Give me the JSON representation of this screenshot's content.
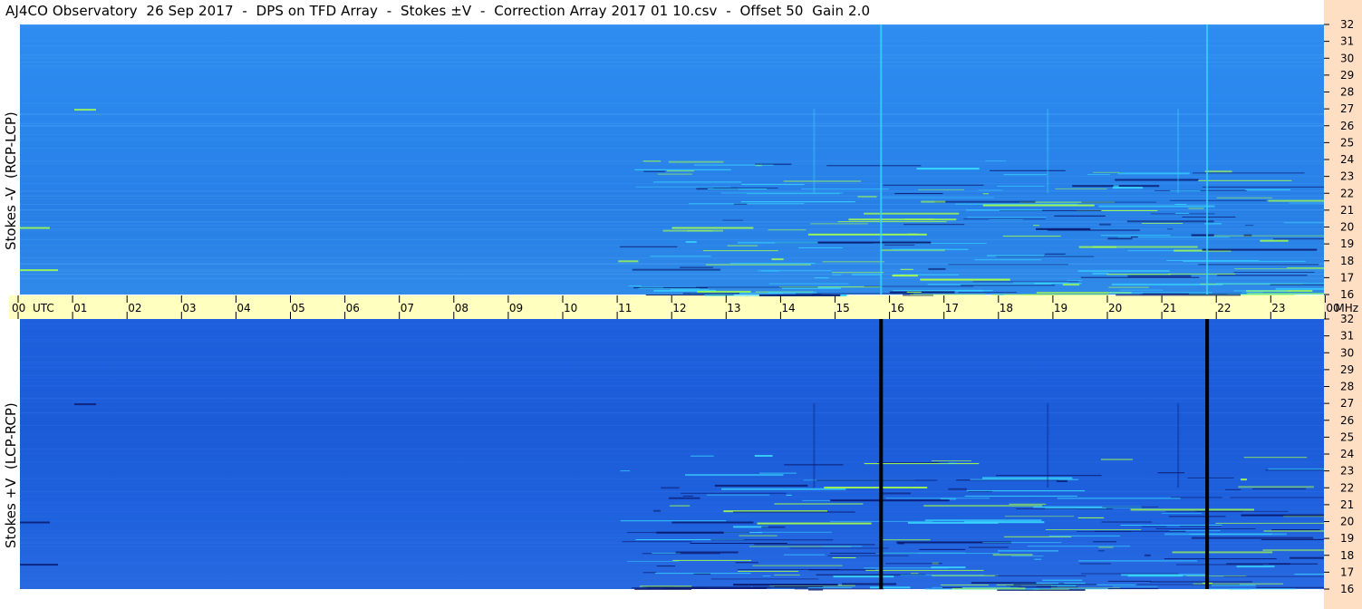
{
  "title": "AJ4CO Observatory  26 Sep 2017  -  DPS on TFD Array  -  Stokes ±V  -  Correction Array 2017 01 10.csv  -  Offset 50  Gain 2.0",
  "colors": {
    "background": "#ffffff",
    "time_bar": "#ffffc0",
    "right_strip": "#ffdfc4",
    "top_panel": "#2a86ec",
    "bottom_panel": "#1d5fdc",
    "emission_bright": "#a6ff4a",
    "emission_cyan": "#39d7ff",
    "emission_dark": "#0a1a70"
  },
  "chart_data": [
    {
      "type": "heatmap",
      "title": "AJ4CO Observatory  26 Sep 2017  -  DPS on TFD Array  -  Stokes ±V  -  Correction Array 2017 01 10.csv  -  Offset 50  Gain 2.0",
      "panel": "top",
      "ylabel": "Stokes -V  (RCP-LCP)",
      "y_unit": "MHz",
      "y_range": [
        16,
        32
      ],
      "y_ticks": [
        "32",
        "31",
        "30",
        "29",
        "28",
        "27",
        "26",
        "25",
        "24",
        "23",
        "22",
        "21",
        "20",
        "19",
        "18",
        "17",
        "16"
      ],
      "x_unit": "UTC",
      "x_range": [
        0,
        24
      ],
      "vertical_lines_utc": [
        15.85,
        21.85
      ],
      "vertical_line_color": "#39d7ff"
    },
    {
      "type": "heatmap",
      "panel": "bottom",
      "ylabel": "Stokes +V  (LCP-RCP)",
      "y_unit": "MHz",
      "y_range": [
        16,
        32
      ],
      "y_ticks": [
        "32",
        "31",
        "30",
        "29",
        "28",
        "27",
        "26",
        "25",
        "24",
        "23",
        "22",
        "21",
        "20",
        "19",
        "18",
        "17",
        "16"
      ],
      "x_unit": "UTC",
      "x_range": [
        0,
        24
      ],
      "vertical_lines_utc": [
        15.85,
        21.85
      ],
      "vertical_line_color": "#000000"
    }
  ],
  "time_axis": {
    "labels": [
      "00",
      "01",
      "02",
      "03",
      "04",
      "05",
      "06",
      "07",
      "08",
      "09",
      "10",
      "11",
      "12",
      "13",
      "14",
      "15",
      "16",
      "17",
      "18",
      "19",
      "20",
      "21",
      "22",
      "23",
      "00"
    ],
    "unit_left": "UTC",
    "unit_right": "MHz"
  }
}
